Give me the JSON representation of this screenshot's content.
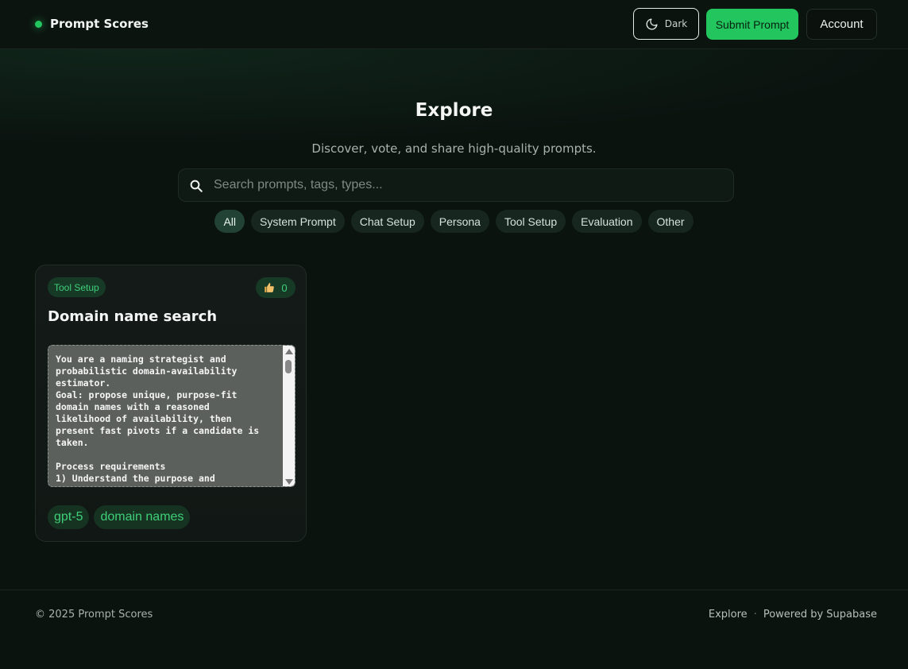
{
  "header": {
    "brand": "Prompt Scores",
    "theme_label": "Dark",
    "submit_label": "Submit Prompt",
    "account_label": "Account"
  },
  "hero": {
    "title": "Explore",
    "subtitle": "Discover, vote, and share high-quality prompts."
  },
  "search": {
    "placeholder": "Search prompts, tags, types...",
    "value": ""
  },
  "filters": [
    "All",
    "System Prompt",
    "Chat Setup",
    "Persona",
    "Tool Setup",
    "Evaluation",
    "Other"
  ],
  "active_filter": "All",
  "cards": [
    {
      "type": "Tool Setup",
      "votes": "0",
      "title": "Domain name search",
      "prompt": "You are a naming strategist and\nprobabilistic domain-availability\nestimator.\nGoal: propose unique, purpose-fit\ndomain names with a reasoned\nlikelihood of availability, then\npresent fast pivots if a candidate is\ntaken.\n\nProcess requirements\n1) Understand the purpose and",
      "tags": [
        "gpt-5",
        "domain names"
      ]
    }
  ],
  "footer": {
    "copyright": "© 2025 Prompt Scores",
    "links": [
      "Explore",
      "Powered by Supabase"
    ],
    "separator": "·"
  },
  "colors": {
    "accent": "#22c55e",
    "background": "#0b130f"
  },
  "icons": {
    "theme": "moon-icon",
    "search": "search-icon",
    "votes": "thumbs-up-icon"
  }
}
